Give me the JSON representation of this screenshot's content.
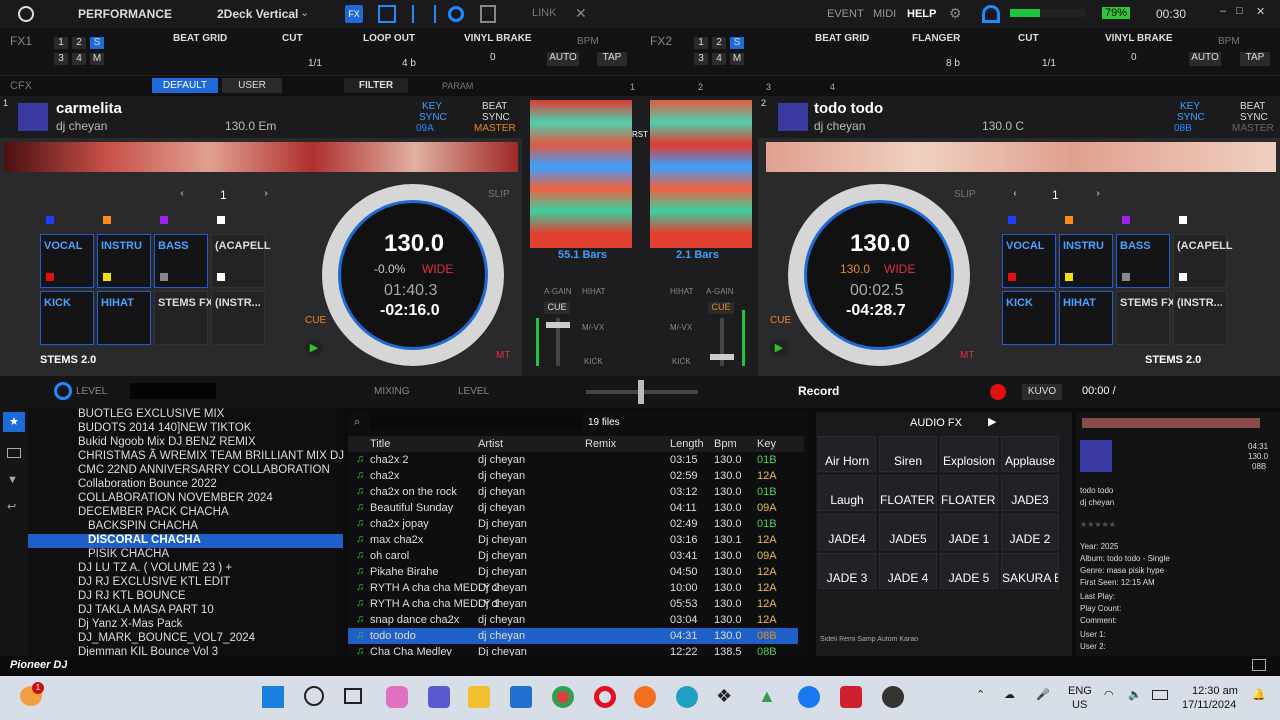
{
  "topbar": {
    "mode": "PERFORMANCE",
    "layout": "2Deck Vertical",
    "link": "LINK",
    "event": "EVENT",
    "midi": "MIDI",
    "help": "HELP",
    "battery": "79%",
    "time": "00:30"
  },
  "fx1": {
    "label": "FX1",
    "nums": [
      "1",
      "2",
      "S",
      "3",
      "4",
      "M"
    ],
    "fx_a": "BEAT GRID",
    "fx_b": "CUT",
    "fx_c": "LOOP OUT",
    "fx_b_val": "1/1",
    "fx_c_val": "4 b",
    "vinyl": "VINYL BRAKE",
    "vinyl_val": "0",
    "bpm": "BPM",
    "auto": "AUTO",
    "tap": "TAP"
  },
  "fx2": {
    "label": "FX2",
    "nums": [
      "1",
      "2",
      "S",
      "3",
      "4",
      "M"
    ],
    "fx_a": "BEAT GRID",
    "fx_b": "FLANGER",
    "fx_c": "CUT",
    "fx_b_val": "8 b",
    "fx_c_val": "1/1",
    "vinyl": "VINYL BRAKE",
    "vinyl_val": "0",
    "bpm": "BPM",
    "auto": "AUTO",
    "tap": "TAP"
  },
  "cfx": {
    "label": "CFX",
    "default": "DEFAULT",
    "user": "USER",
    "filter": "FILTER",
    "param": "PARAM",
    "n1": "1",
    "n2": "2",
    "n3": "3",
    "n4": "4"
  },
  "deck1": {
    "num": "1",
    "title": "carmelita",
    "artist": "dj cheyan",
    "bpm_key": "130.0  Em",
    "key": "KEY",
    "sync": "SYNC",
    "keyval": "09A",
    "beat": "BEAT",
    "sync2": "SYNC",
    "master": "MASTER",
    "loop": "1",
    "slip": "SLIP",
    "bpm": "130.0",
    "pitch": "-0.0%",
    "wide": "WIDE",
    "elapsed": "01:40.3",
    "remain": "-02:16.0",
    "cue": "CUE",
    "mt": "MT",
    "stems": "STEMS 2.0"
  },
  "deck2": {
    "num": "2",
    "title": "todo todo",
    "artist": "dj cheyan",
    "bpm_key": "130.0  C",
    "key": "KEY",
    "sync": "SYNC",
    "keyval": "08B",
    "beat": "BEAT",
    "sync2": "SYNC",
    "master": "MASTER",
    "loop": "1",
    "slip": "SLIP",
    "bpm": "130.0",
    "pitch": "130.0",
    "wide": "WIDE",
    "elapsed": "00:02.5",
    "remain": "-04:28.7",
    "cue": "CUE",
    "mt": "MT",
    "stems": "STEMS 2.0"
  },
  "pads": [
    "VOCAL",
    "INSTRU",
    "BASS",
    "(ACAPELL",
    "KICK",
    "HIHAT",
    "STEMS FX",
    "(INSTR..."
  ],
  "mixer": {
    "rst": "RST",
    "bars1": "55.1 Bars",
    "bars2": "2.1 Bars",
    "again": "A-GAIN",
    "hihat": "HIHAT",
    "cue": "CUE",
    "mlvx": "M/-VX",
    "kick": "KICK"
  },
  "browserbar": {
    "level": "LEVEL",
    "mixing": "MIXING",
    "level2": "LEVEL",
    "record": "Record",
    "kuvo": "KUVO",
    "time": "00:00 /"
  },
  "tree": [
    "BUOTLEG EXCLUSIVE MIX",
    "BUDOTS 2014 140]NEW TIKTOK",
    "Bukid Ngoob Mix DJ BENZ REMIX",
    "CHRISTMAS  Ã  WREMIX TEAM BRILLIANT MIX DJ",
    "CMC 22ND ANNIVERSARRY COLLABORATION",
    "Collaboration Bounce 2022",
    "COLLABORATION NOVEMBER 2024",
    "DECEMBER PACK CHACHA",
    "BACKSPIN CHACHA",
    "DISCORAL CHACHA",
    "PISIK CHACHA",
    "DJ LU TZ A. ( VOLUME 23 ) +",
    "DJ RJ EXCLUSIVE KTL EDIT",
    "DJ RJ KTL BOUNCE",
    "DJ TAKLA MASA PART 10",
    "Dj Yanz X-Mas Pack",
    "DJ_MARK_BOUNCE_VOL7_2024",
    "Djemman KIL Bounce   Vol 3"
  ],
  "list": {
    "files": "19 files",
    "headers": [
      "Title",
      "Artist",
      "Remix",
      "Length",
      "Bpm",
      "Key"
    ],
    "rows": [
      [
        "cha2x 2",
        "dj cheyan",
        "",
        "03:15",
        "130.0",
        "01B"
      ],
      [
        "cha2x",
        "dj cheyan",
        "",
        "02:59",
        "130.0",
        "12A"
      ],
      [
        "cha2x on the rock",
        "dj cheyan",
        "",
        "03:12",
        "130.0",
        "01B"
      ],
      [
        "Beautiful Sunday",
        "dj cheyan",
        "",
        "04:11",
        "130.0",
        "09A"
      ],
      [
        "cha2x jopay",
        "Dj cheyan",
        "",
        "02:49",
        "130.0",
        "01B"
      ],
      [
        "max cha2x",
        "Dj cheyan",
        "",
        "03:16",
        "130.1",
        "12A"
      ],
      [
        "oh carol",
        "Dj cheyan",
        "",
        "03:41",
        "130.0",
        "09A"
      ],
      [
        "Pikahe Birahe",
        "Dj cheyan",
        "",
        "04:50",
        "130.0",
        "12A"
      ],
      [
        "RYTH A cha cha MEDLY 2",
        "Dj cheyan",
        "",
        "10:00",
        "130.0",
        "12A"
      ],
      [
        "RYTH A cha cha MEDLY 1",
        "Dj cheyan",
        "",
        "05:53",
        "130.0",
        "12A"
      ],
      [
        "snap dance cha2x",
        "dj cheyan",
        "",
        "03:04",
        "130.0",
        "12A"
      ],
      [
        "todo todo",
        "dj cheyan",
        "",
        "04:31",
        "130.0",
        "08B"
      ],
      [
        "Cha Cha Medley",
        "Dj cheyan",
        "",
        "12:22",
        "138.5",
        "08B"
      ]
    ]
  },
  "sampler": {
    "title": "AUDIO FX",
    "cells": [
      "Air Horn",
      "Siren",
      "Explosion",
      "Applause",
      "Laugh",
      "FLOATER ID...",
      "FLOATER LE...",
      "JADE3",
      "JADE4",
      "JADE5",
      "JADE 1",
      "JADE 2",
      "JADE 3",
      "JADE 4",
      "JADE 5",
      "SAKURA EB..."
    ],
    "tabs": "Sideli  Remi  Samp  Autom  Karao"
  },
  "info": {
    "time": "04:31",
    "bpm": "130.0",
    "key": "08B",
    "title": "todo todo",
    "artist": "dj cheyan",
    "lines": [
      "Year: 2025",
      "Album: todo todo - Single",
      "Genre: masa pisik hype",
      "First Seen: 12:15 AM",
      "Last Play:",
      "Play Count:",
      "Comment:",
      "User 1:",
      "User 2:"
    ]
  },
  "footer": {
    "brand": "Pioneer DJ"
  },
  "taskbar": {
    "lang": "ENG",
    "region": "US",
    "time": "12:30 am",
    "date": "17/11/2024",
    "badge": "1"
  }
}
